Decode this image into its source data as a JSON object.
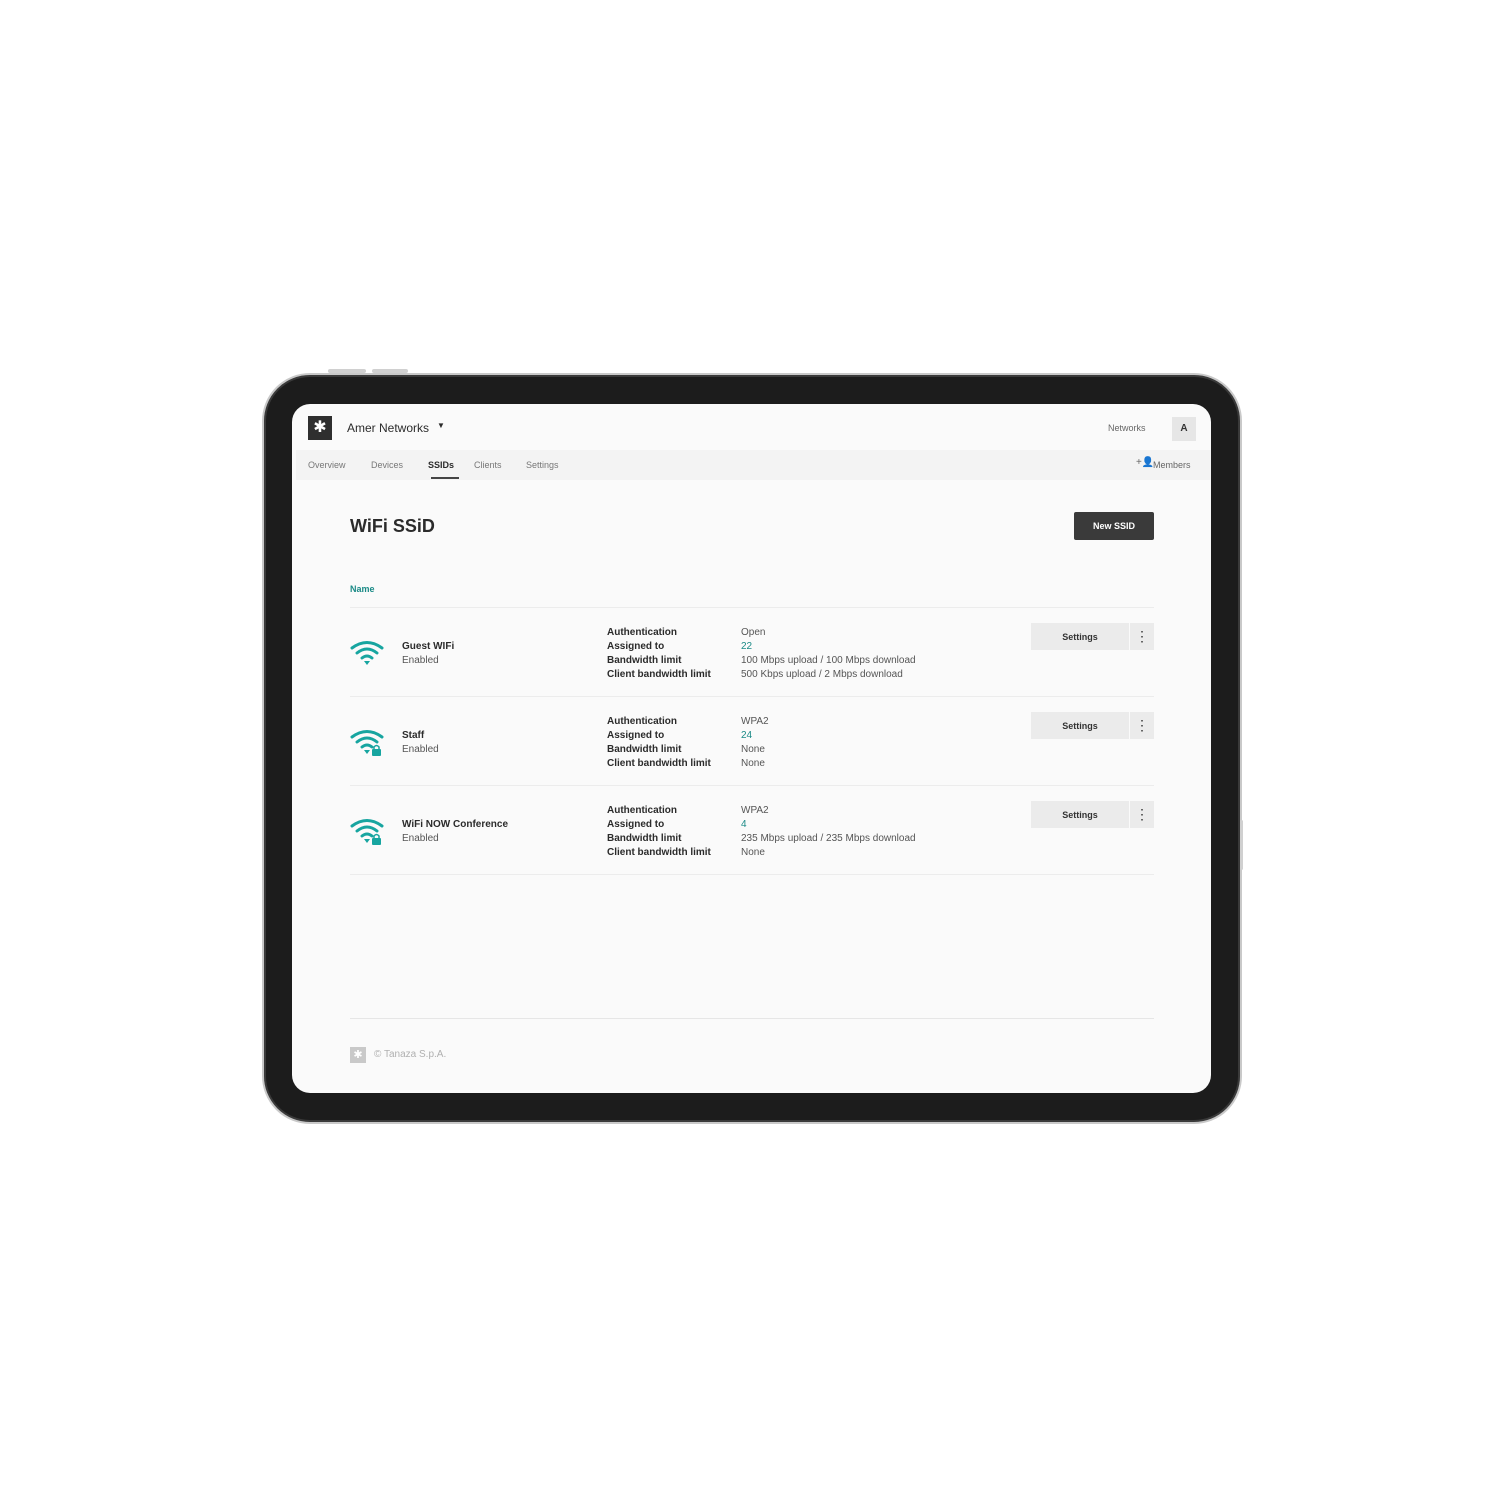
{
  "app": {
    "logo_glyph": "✱",
    "org_name": "Amer Networks",
    "org_caret": "▼",
    "networks_link": "Networks",
    "avatar_initial": "A"
  },
  "nav": {
    "tabs": [
      {
        "label": "Overview",
        "active": false
      },
      {
        "label": "Devices",
        "active": false
      },
      {
        "label": "SSIDs",
        "active": true
      },
      {
        "label": "Clients",
        "active": false
      },
      {
        "label": "Settings",
        "active": false
      }
    ],
    "members_icon": "+👤",
    "members_label": "Members"
  },
  "page": {
    "title": "WiFi SSiD",
    "new_button": "New SSID",
    "column_name": "Name"
  },
  "ssids": [
    {
      "name": "Guest WIFi",
      "status": "Enabled",
      "secured": false,
      "labels": [
        "Authentication",
        "Assigned to",
        "Bandwidth limit",
        "Client bandwidth limit"
      ],
      "authentication": "Open",
      "assigned_to": "22",
      "bandwidth_limit": "100 Mbps upload / 100 Mbps download",
      "client_bandwidth_limit": "500 Kbps upload / 2 Mbps download",
      "settings_label": "Settings",
      "more_glyph": "⋮"
    },
    {
      "name": "Staff",
      "status": "Enabled",
      "secured": true,
      "labels": [
        "Authentication",
        "Assigned to",
        "Bandwidth limit",
        "Client bandwidth limit"
      ],
      "authentication": "WPA2",
      "assigned_to": "24",
      "bandwidth_limit": "None",
      "client_bandwidth_limit": "None",
      "settings_label": "Settings",
      "more_glyph": "⋮"
    },
    {
      "name": "WiFi NOW Conference",
      "status": "Enabled",
      "secured": true,
      "labels": [
        "Authentication",
        "Assigned to",
        "Bandwidth limit",
        "Client bandwidth limit"
      ],
      "authentication": "WPA2",
      "assigned_to": "4",
      "bandwidth_limit": "235 Mbps upload / 235 Mbps download",
      "client_bandwidth_limit": "None",
      "settings_label": "Settings",
      "more_glyph": "⋮"
    }
  ],
  "footer": {
    "logo_glyph": "✱",
    "copyright": "© Tanaza S.p.A."
  },
  "colors": {
    "accent": "#1a8a86",
    "wifi_icon": "#17a5a0",
    "primary_button": "#3a3a3a"
  }
}
